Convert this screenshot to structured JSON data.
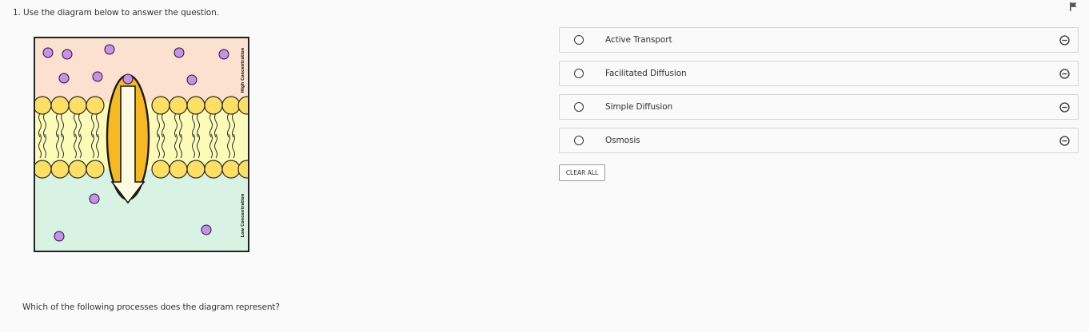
{
  "question": {
    "stem": "1. Use the diagram below to answer the question.",
    "prompt": "Which of the following processes does the diagram represent?"
  },
  "diagram": {
    "top_label": "High Concentration",
    "bottom_label": "Low Concentration",
    "colors": {
      "high_region": "#fde1d0",
      "low_region": "#d8f2e4",
      "membrane": "#fdfbb8",
      "lipid_head": "#fde063",
      "channel": "#f6b91f",
      "particle": "#c98ef0"
    }
  },
  "choices": [
    {
      "label": "Active Transport"
    },
    {
      "label": "Facilitated Diffusion"
    },
    {
      "label": "Simple Diffusion"
    },
    {
      "label": "Osmosis"
    }
  ],
  "actions": {
    "clear_all": "CLEAR ALL"
  },
  "icons": {
    "flag": "flag-icon",
    "eliminate": "minus-circle-icon"
  }
}
